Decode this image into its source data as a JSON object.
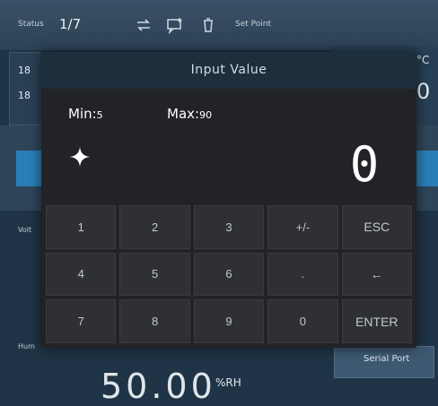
{
  "background": {
    "status_label": "Status",
    "status_value": "1/7",
    "setpoint_label": "Set Point",
    "left_row1": "18",
    "left_row2": "18",
    "unit_c": "°C",
    "right_digit": "0",
    "voltage_label": "Volt",
    "humidity_label": "Hum",
    "serial_port_label": "Serial Port",
    "humidity_value": "50.00",
    "humidity_unit": "%RH",
    "accent": "#2b7fb8"
  },
  "dialog": {
    "title": "Input Value",
    "min_label": "Min:",
    "min_value": "5",
    "max_label": "Max:",
    "max_value": "90",
    "current_value": "0",
    "sign_icon": "plus-minus-sparkle-icon"
  },
  "keypad": {
    "keys": [
      "1",
      "2",
      "3",
      "+/-",
      "ESC",
      "4",
      "5",
      "6",
      ".",
      "←",
      "7",
      "8",
      "9",
      "0",
      "ENTER"
    ]
  }
}
